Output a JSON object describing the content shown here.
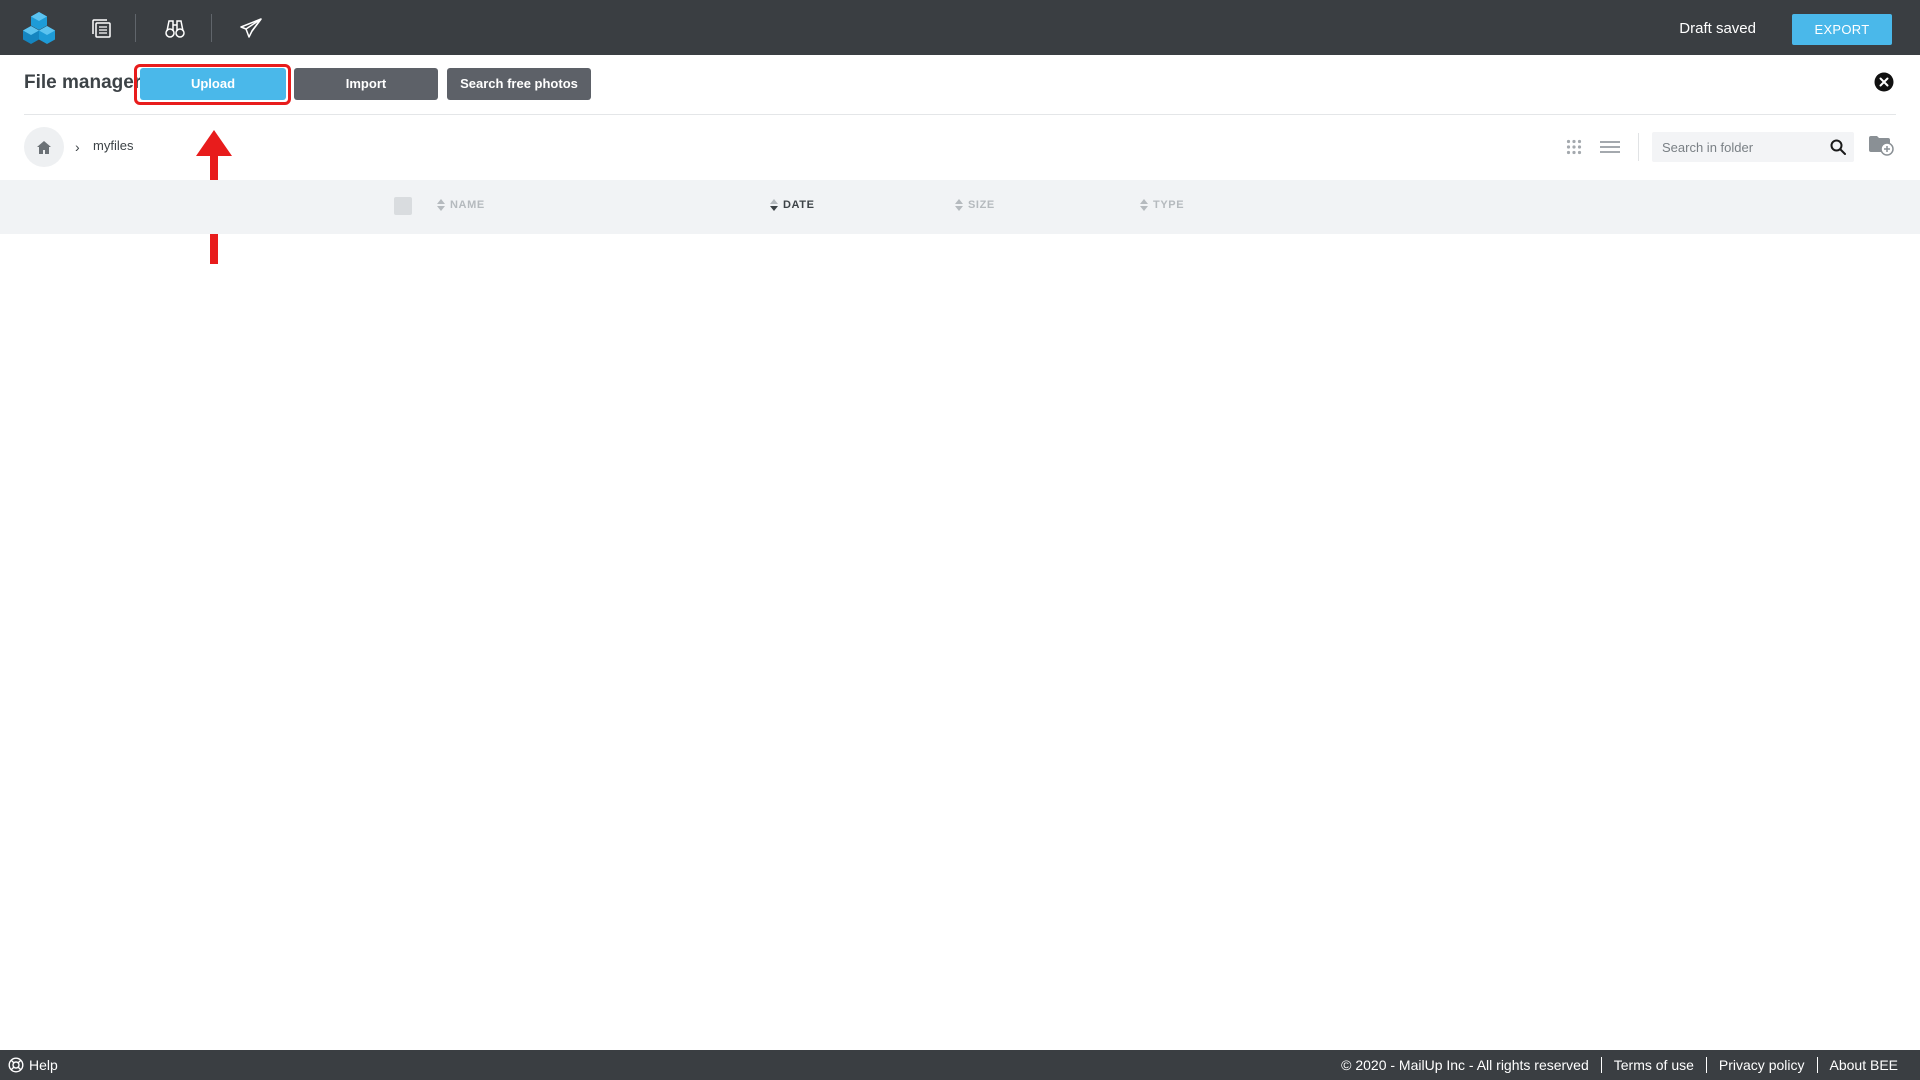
{
  "topbar": {
    "logo_icon": "bee-cubes-logo-icon",
    "tool_icons": [
      "pages-icon",
      "binoculars-icon",
      "send-plane-icon"
    ],
    "status": "Draft saved",
    "export_label": "EXPORT"
  },
  "file_manager": {
    "title": "File manager",
    "upload_label": "Upload",
    "import_label": "Import",
    "photos_label": "Search free photos",
    "close_icon": "close-circle-icon"
  },
  "breadcrumb": {
    "home_icon": "home-icon",
    "folder": "myfiles"
  },
  "search": {
    "placeholder": "Search in folder"
  },
  "table": {
    "columns": [
      {
        "label": "NAME",
        "active": false
      },
      {
        "label": "DATE",
        "active": true
      },
      {
        "label": "SIZE",
        "active": false
      },
      {
        "label": "TYPE",
        "active": false
      }
    ]
  },
  "footer": {
    "help_label": "Help",
    "copyright": "© 2020 - MailUp Inc - All rights reserved",
    "links": [
      "Terms of use",
      "Privacy policy",
      "About BEE"
    ]
  },
  "colors": {
    "accent": "#4ab8ea",
    "bar": "#3a3e42",
    "secondary_button": "#5d6168",
    "highlight": "#e81c1c"
  }
}
